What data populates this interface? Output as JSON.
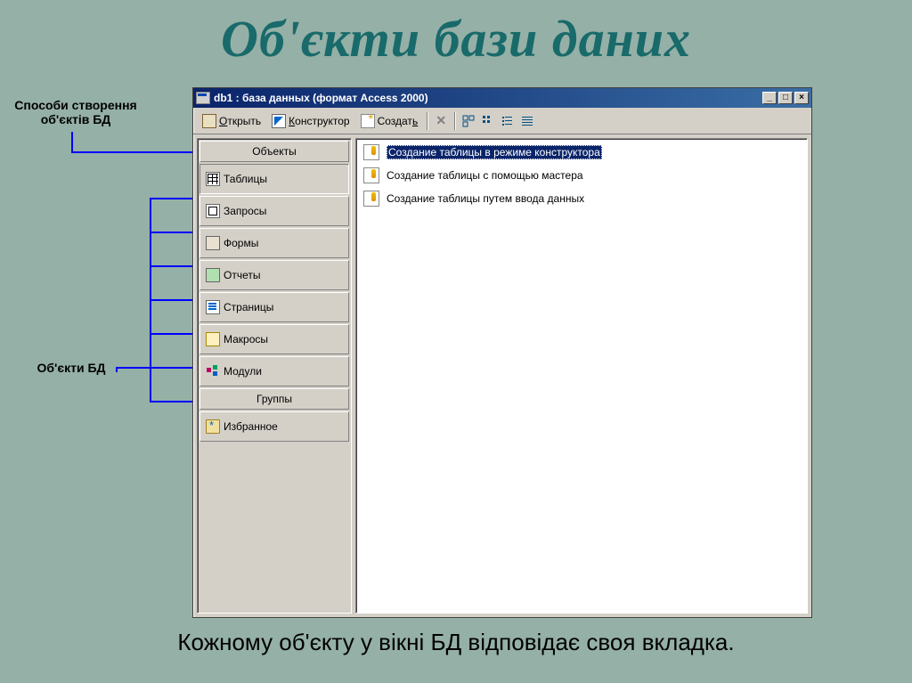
{
  "slide": {
    "title": "Об'єкти бази даних",
    "footer": "Кожному об'єкту у вікні БД відповідає своя вкладка."
  },
  "callouts": {
    "creation_methods": "Способи створення об'єктів БД",
    "db_objects": "Об'єкти БД"
  },
  "window": {
    "title": "db1 : база данных (формат Access 2000)"
  },
  "toolbar": {
    "open": "Открыть",
    "design": "Конструктор",
    "create": "Создать"
  },
  "nav": {
    "objects_header": "Объекты",
    "groups_header": "Группы",
    "items": [
      {
        "label": "Таблицы"
      },
      {
        "label": "Запросы"
      },
      {
        "label": "Формы"
      },
      {
        "label": "Отчеты"
      },
      {
        "label": "Страницы"
      },
      {
        "label": "Макросы"
      },
      {
        "label": "Модули"
      }
    ],
    "favorites": "Избранное"
  },
  "content": {
    "items": [
      {
        "label": "Создание таблицы в режиме конструктора"
      },
      {
        "label": "Создание таблицы с помощью мастера"
      },
      {
        "label": "Создание таблицы путем ввода данных"
      }
    ]
  }
}
